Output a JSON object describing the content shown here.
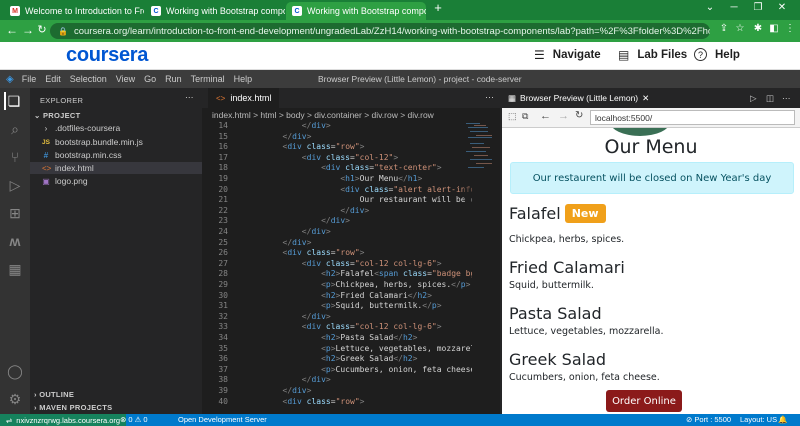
{
  "browser": {
    "tabs": [
      {
        "label": "Welcome to Introduction to Fro",
        "icon": "gmail-icon"
      },
      {
        "label": "Working with Bootstrap compo",
        "icon": "coursera-icon"
      },
      {
        "label": "Working with Bootstrap compo",
        "icon": "coursera-icon",
        "active": true
      }
    ],
    "new_tab": "+",
    "url": "coursera.org/learn/introduction-to-front-end-development/ungradedLab/ZzH14/working-with-bootstrap-components/lab?path=%2F%3Ffolder%3D%2Fhom..."
  },
  "coursera": {
    "logo": "coursera",
    "navigate": "Navigate",
    "lab_files": "Lab Files",
    "help": "Help"
  },
  "vscode": {
    "menu": [
      "File",
      "Edit",
      "Selection",
      "View",
      "Go",
      "Run",
      "Terminal",
      "Help"
    ],
    "window_title": "Browser Preview (Little Lemon) - project - code-server",
    "explorer": {
      "title": "EXPLORER",
      "project": "PROJECT",
      "files": [
        {
          "name": ".dotfiles-coursera",
          "kind": "folder"
        },
        {
          "name": "bootstrap.bundle.min.js",
          "kind": "js"
        },
        {
          "name": "bootstrap.min.css",
          "kind": "css"
        },
        {
          "name": "index.html",
          "kind": "html",
          "selected": true
        },
        {
          "name": "logo.png",
          "kind": "png"
        }
      ],
      "outline": "OUTLINE",
      "maven": "MAVEN PROJECTS"
    },
    "editor": {
      "tab": "index.html",
      "breadcrumb": "index.html > html > body > div.container > div.row > div.row",
      "lines": [
        {
          "n": "14",
          "html": "            <span class='pu'>&lt;/</span><span class='tg'>div</span><span class='pu'>&gt;</span>"
        },
        {
          "n": "15",
          "html": "        <span class='pu'>&lt;/</span><span class='tg'>div</span><span class='pu'>&gt;</span>"
        },
        {
          "n": "16",
          "html": "        <span class='pu'>&lt;</span><span class='tg'>div</span> <span class='at'>class</span>=<span class='st'>\"row\"</span><span class='pu'>&gt;</span>"
        },
        {
          "n": "17",
          "html": "            <span class='pu'>&lt;</span><span class='tg'>div</span> <span class='at'>class</span>=<span class='st'>\"col-12\"</span><span class='pu'>&gt;</span>"
        },
        {
          "n": "18",
          "html": "                <span class='pu'>&lt;</span><span class='tg'>div</span> <span class='at'>class</span>=<span class='st'>\"text-center\"</span><span class='pu'>&gt;</span>"
        },
        {
          "n": "19",
          "html": "                    <span class='pu'>&lt;</span><span class='tg'>h1</span><span class='pu'>&gt;</span>Our Menu<span class='pu'>&lt;/</span><span class='tg'>h1</span><span class='pu'>&gt;</span>"
        },
        {
          "n": "20",
          "html": "                    <span class='pu'>&lt;</span><span class='tg'>div</span> <span class='at'>class</span>=<span class='st'>\"alert alert-info</span>"
        },
        {
          "n": "21",
          "html": "                        Our restaurant will be c"
        },
        {
          "n": "22",
          "html": "                    <span class='pu'>&lt;/</span><span class='tg'>div</span><span class='pu'>&gt;</span>"
        },
        {
          "n": "23",
          "html": "                <span class='pu'>&lt;/</span><span class='tg'>div</span><span class='pu'>&gt;</span>"
        },
        {
          "n": "24",
          "html": "            <span class='pu'>&lt;/</span><span class='tg'>div</span><span class='pu'>&gt;</span>"
        },
        {
          "n": "25",
          "html": "        <span class='pu'>&lt;/</span><span class='tg'>div</span><span class='pu'>&gt;</span>"
        },
        {
          "n": "26",
          "html": "        <span class='pu'>&lt;</span><span class='tg'>div</span> <span class='at'>class</span>=<span class='st'>\"row\"</span><span class='pu'>&gt;</span>"
        },
        {
          "n": "27",
          "html": "            <span class='pu'>&lt;</span><span class='tg'>div</span> <span class='at'>class</span>=<span class='st'>\"col-12 col-lg-6\"</span><span class='pu'>&gt;</span>"
        },
        {
          "n": "28",
          "html": "                <span class='pu'>&lt;</span><span class='tg'>h2</span><span class='pu'>&gt;</span>Falafel<span class='pu'>&lt;</span><span class='tg'>span</span> <span class='at'>class</span>=<span class='st'>\"badge bg</span>"
        },
        {
          "n": "29",
          "html": "                <span class='pu'>&lt;</span><span class='tg'>p</span><span class='pu'>&gt;</span>Chickpea, herbs, spices.<span class='pu'>&lt;/</span><span class='tg'>p</span><span class='pu'>&gt;</span>"
        },
        {
          "n": "30",
          "html": "                <span class='pu'>&lt;</span><span class='tg'>h2</span><span class='pu'>&gt;</span>Fried Calamari<span class='pu'>&lt;/</span><span class='tg'>h2</span><span class='pu'>&gt;</span>"
        },
        {
          "n": "31",
          "html": "                <span class='pu'>&lt;</span><span class='tg'>p</span><span class='pu'>&gt;</span>Squid, buttermilk.<span class='pu'>&lt;/</span><span class='tg'>p</span><span class='pu'>&gt;</span>"
        },
        {
          "n": "32",
          "html": "            <span class='pu'>&lt;/</span><span class='tg'>div</span><span class='pu'>&gt;</span>"
        },
        {
          "n": "33",
          "html": "            <span class='pu'>&lt;</span><span class='tg'>div</span> <span class='at'>class</span>=<span class='st'>\"col-12 col-lg-6\"</span><span class='pu'>&gt;</span>"
        },
        {
          "n": "34",
          "html": "                <span class='pu'>&lt;</span><span class='tg'>h2</span><span class='pu'>&gt;</span>Pasta Salad<span class='pu'>&lt;/</span><span class='tg'>h2</span><span class='pu'>&gt;</span>"
        },
        {
          "n": "35",
          "html": "                <span class='pu'>&lt;</span><span class='tg'>p</span><span class='pu'>&gt;</span>Lettuce, vegetables, mozzarel"
        },
        {
          "n": "36",
          "html": "                <span class='pu'>&lt;</span><span class='tg'>h2</span><span class='pu'>&gt;</span>Greek Salad<span class='pu'>&lt;/</span><span class='tg'>h2</span><span class='pu'>&gt;</span>"
        },
        {
          "n": "37",
          "html": "                <span class='pu'>&lt;</span><span class='tg'>p</span><span class='pu'>&gt;</span>Cucumbers, onion, feta cheese"
        },
        {
          "n": "38",
          "html": "            <span class='pu'>&lt;/</span><span class='tg'>div</span><span class='pu'>&gt;</span>"
        },
        {
          "n": "39",
          "html": "        <span class='pu'>&lt;/</span><span class='tg'>div</span><span class='pu'>&gt;</span>"
        },
        {
          "n": "40",
          "html": "        <span class='pu'>&lt;</span><span class='tg'>div</span> <span class='at'>class</span>=<span class='st'>\"row\"</span><span class='pu'>&gt;</span>"
        }
      ]
    },
    "preview": {
      "tab": "Browser Preview (Little Lemon)",
      "url": "localhost:5500/",
      "title": "Our Menu",
      "alert": "Our restaurent will be closed on New Year's day",
      "badge": "New",
      "dishes": [
        {
          "name": "Falafel",
          "desc": "Chickpea, herbs, spices."
        },
        {
          "name": "Fried Calamari",
          "desc": "Squid, buttermilk."
        },
        {
          "name": "Pasta Salad",
          "desc": "Lettuce, vegetables, mozzarella."
        },
        {
          "name": "Greek Salad",
          "desc": "Cucumbers, onion, feta cheese."
        }
      ],
      "order": "Order Online"
    },
    "status": {
      "remote": "nxivznzrqrwg.labs.coursera.org",
      "problems": "⊗ 0 ⚠ 0",
      "server": "Open Development Server",
      "port": "Port : 5500",
      "layout": "Layout: US"
    }
  }
}
